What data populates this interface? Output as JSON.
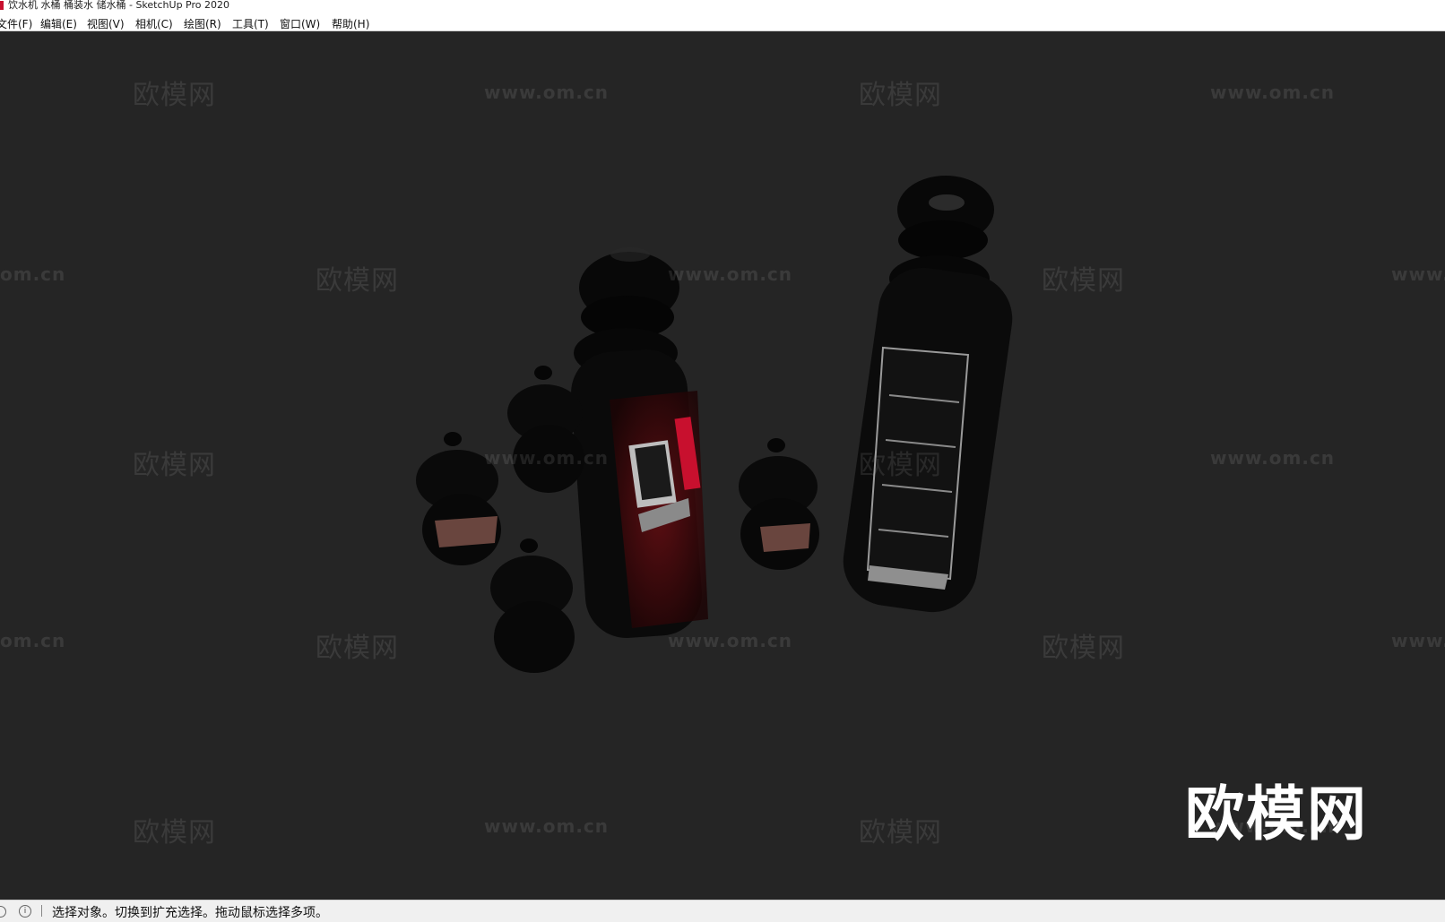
{
  "window": {
    "title": "饮水机 水桶 桶装水 储水桶 - SketchUp Pro 2020"
  },
  "menu": [
    "文件(F)",
    "编辑(E)",
    "视图(V)",
    "相机(C)",
    "绘图(R)",
    "工具(T)",
    "窗口(W)",
    "帮助(H)"
  ],
  "watermark": {
    "cn": "欧模网",
    "url": "www.om.cn",
    "url_fragment_left": "om.cn",
    "url_fragment_right": "www."
  },
  "status": {
    "text": "选择对象。切换到扩充选择。拖动鼠标选择多项。"
  },
  "icons": {
    "status_left": "geolocation-icon",
    "status_info": "info-icon"
  },
  "colors": {
    "viewport_bg": "#252525",
    "model_red": "#c8102e",
    "statusbar_bg": "#f0f0f0"
  }
}
